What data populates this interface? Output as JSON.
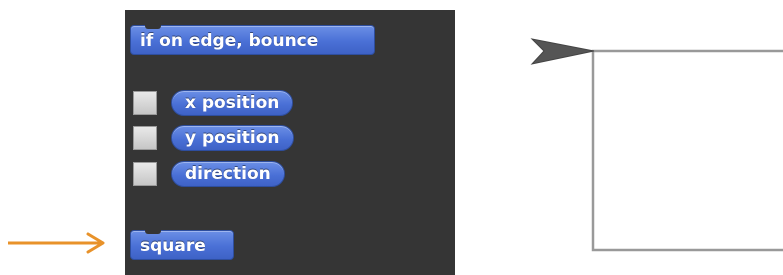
{
  "palette": {
    "blocks": {
      "bounce_label": "if on edge, bounce",
      "custom_block_label": "square"
    },
    "reporters": [
      {
        "label": "x position",
        "checked": false
      },
      {
        "label": "y position",
        "checked": false
      },
      {
        "label": "direction",
        "checked": false
      }
    ],
    "block_color": "#4a70d6",
    "background_color": "#353535"
  },
  "annotation": {
    "arrow_color": "#e8922a",
    "arrow_icon": "right-arrow-icon"
  },
  "stage": {
    "sprite_icon": "arrowhead-sprite-icon",
    "pen_color": "#999999",
    "sprite_color": "#555555"
  }
}
